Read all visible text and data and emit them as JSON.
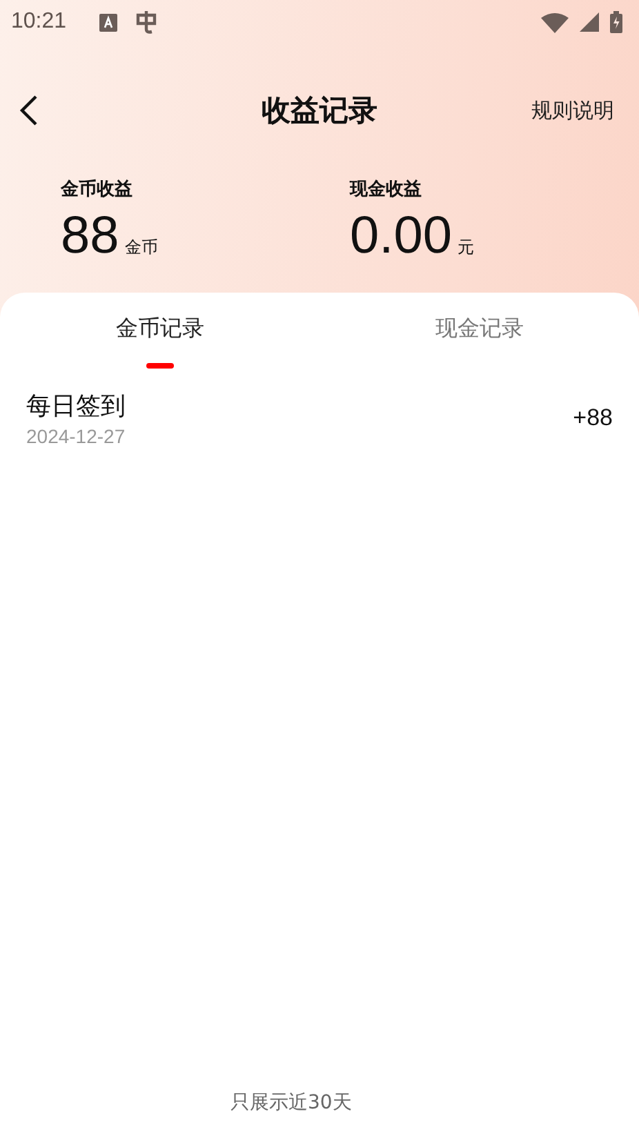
{
  "status_bar": {
    "time": "10:21"
  },
  "header": {
    "title": "收益记录",
    "action": "规则说明"
  },
  "stats": [
    {
      "label": "金币收益",
      "value": "88",
      "unit": "金币"
    },
    {
      "label": "现金收益",
      "value": "0.00",
      "unit": "元"
    }
  ],
  "tabs": [
    {
      "label": "金币记录",
      "selected": true
    },
    {
      "label": "现金记录",
      "selected": false
    }
  ],
  "records": [
    {
      "title": "每日签到",
      "date": "2024-12-27",
      "amount": "+88"
    }
  ],
  "footer": {
    "note": "只展示近30天"
  }
}
